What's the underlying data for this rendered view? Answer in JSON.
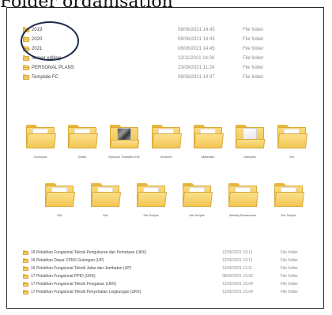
{
  "caption": "Folder organisation",
  "top_list": [
    {
      "name": "2019",
      "date": "08/06/2021 14:45",
      "type": "File folder"
    },
    {
      "name": "2020",
      "date": "08/06/2021 14:45",
      "type": "File folder"
    },
    {
      "name": "2021",
      "date": "08/06/2021 14:45",
      "type": "File folder"
    },
    {
      "name": "Server editing",
      "date": "22/11/2021 14:26",
      "type": "File folder"
    },
    {
      "name": "PERSONAL PLANS",
      "date": "23/09/2021 11:24",
      "type": "File folder"
    },
    {
      "name": "Template FC",
      "date": "08/06/2021 14:47",
      "type": "File folder"
    }
  ],
  "grid_row1": [
    {
      "label": "Contracts",
      "kind": "paper"
    },
    {
      "label": "Drafts",
      "kind": "paper"
    },
    {
      "label": "Episode Transfers HD",
      "kind": "photo"
    },
    {
      "label": "Invoices",
      "kind": "paper"
    },
    {
      "label": "Materials",
      "kind": "paper"
    },
    {
      "label": "Samples",
      "kind": "doc"
    },
    {
      "label": "Set",
      "kind": "paper"
    }
  ],
  "grid_row2": [
    {
      "label": "Old",
      "kind": "paper"
    },
    {
      "label": "Old",
      "kind": "paper"
    },
    {
      "label": "Set Scripts",
      "kind": "paper"
    },
    {
      "label": "Set Scripts",
      "kind": "paper"
    },
    {
      "label": "Weekly Breakdown",
      "kind": "paper"
    },
    {
      "label": "Set Scripts",
      "kind": "paper"
    }
  ],
  "bottom_list": [
    {
      "name": "16 Pelatihan Fungsional Teknik Pengukuran dan Pemetaan (UKK)",
      "date": "12/05/2021 10:11",
      "type": "File folder"
    },
    {
      "name": "16 Pelatihan Dasar CPNS Golongan (UP)",
      "date": "12/05/2021 10:11",
      "type": "File folder"
    },
    {
      "name": "16 Pelatihan Fungsional Teknik Jalan dan Jembatan (UP)",
      "date": "12/05/2021 11:11",
      "type": "File folder"
    },
    {
      "name": "17 Pelatihan Fungsional PPID (UKK)",
      "date": "08/06/2021 10:06",
      "type": "File folder"
    },
    {
      "name": "17 Pelatihan Fungsional Teknik Pengairan (UKK)",
      "date": "12/05/2021 10:04",
      "type": "File folder"
    },
    {
      "name": "17 Pelatihan Fungsional Teknik Penyehatan Lingkungan (UKK)",
      "date": "12/05/2021 10:04",
      "type": "File folder"
    }
  ]
}
